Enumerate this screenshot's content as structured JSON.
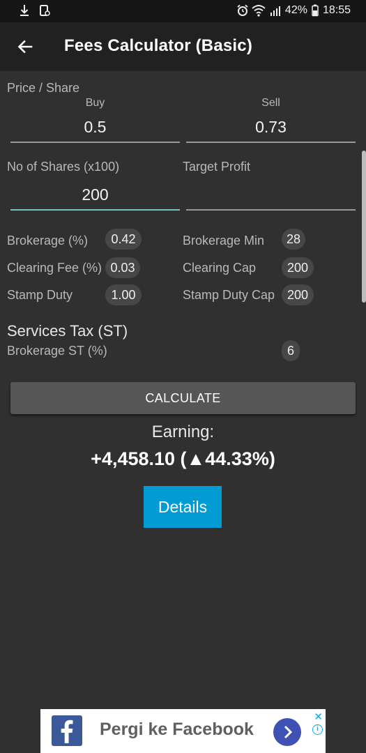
{
  "status_bar": {
    "battery": "42%",
    "time": "18:55",
    "left_icons": [
      "download-icon",
      "screenshot-icon"
    ],
    "right_icons": [
      "alarm-icon",
      "wifi-icon",
      "signal-icon",
      "battery-icon"
    ]
  },
  "app_bar": {
    "back_icon": "arrow-left-icon",
    "title": "Fees Calculator (Basic)"
  },
  "price_share": {
    "label": "Price / Share",
    "buy_label": "Buy",
    "buy_value": "0.5",
    "sell_label": "Sell",
    "sell_value": "0.73"
  },
  "shares": {
    "label": "No of Shares (x100)",
    "value": "200"
  },
  "target_profit": {
    "label": "Target Profit",
    "value": ""
  },
  "fees": {
    "brokerage_label": "Brokerage (%)",
    "brokerage_value": "0.42",
    "brokerage_min_label": "Brokerage Min",
    "brokerage_min_value": "28",
    "clearing_fee_label": "Clearing Fee (%)",
    "clearing_fee_value": "0.03",
    "clearing_cap_label": "Clearing Cap",
    "clearing_cap_value": "200",
    "stamp_duty_label": "Stamp Duty",
    "stamp_duty_value": "1.00",
    "stamp_duty_cap_label": "Stamp Duty Cap",
    "stamp_duty_cap_value": "200"
  },
  "services_tax": {
    "title": "Services Tax (ST)",
    "brokerage_st_label": "Brokerage ST (%)",
    "brokerage_st_value": "6"
  },
  "actions": {
    "calculate_label": "CALCULATE",
    "details_label": "Details"
  },
  "result": {
    "earning_label": "Earning:",
    "earning_value": "+4,458.10 (▲44.33%)"
  },
  "ad": {
    "text": "Pergi ke Facebook",
    "brand_icon": "facebook-icon",
    "colors": {
      "brand": "#3b5998",
      "button": "#3f51b5",
      "adchoices": "#00aaf0"
    }
  },
  "colors": {
    "background": "#303030",
    "app_bar": "#212121",
    "accent_underline": "#6fc5c1",
    "details_button": "#039bd4"
  }
}
